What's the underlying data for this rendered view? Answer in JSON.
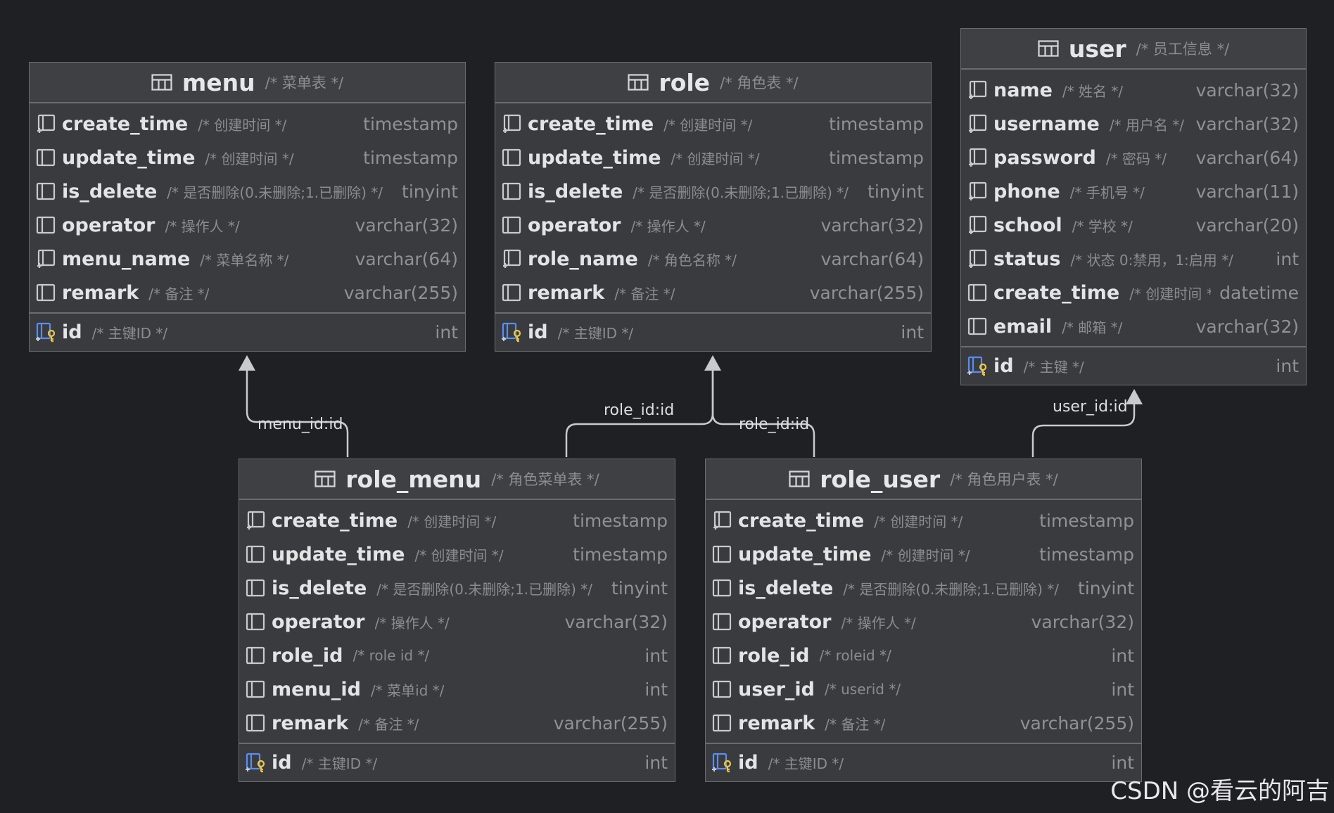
{
  "colors": {
    "background": "#1f2024",
    "entity_bg": "#393b3e",
    "border": "#6a6c70",
    "key_icon": "#f3c83a",
    "column_icon": "#c9cacd",
    "pk_icon": "#5b8def"
  },
  "entities": {
    "menu": {
      "name": "menu",
      "comment": "/* 菜单表 */",
      "columns": [
        {
          "name": "create_time",
          "comment": "/* 创建时间 */",
          "type": "timestamp",
          "icon": "column-index-icon"
        },
        {
          "name": "update_time",
          "comment": "/* 创建时间 */",
          "type": "timestamp",
          "icon": "column-icon"
        },
        {
          "name": "is_delete",
          "comment": "/* 是否删除(0.未删除;1.已删除) */",
          "type": "tinyint",
          "icon": "column-icon"
        },
        {
          "name": "operator",
          "comment": "/* 操作人 */",
          "type": "varchar(32)",
          "icon": "column-icon"
        },
        {
          "name": "menu_name",
          "comment": "/* 菜单名称 */",
          "type": "varchar(64)",
          "icon": "column-index-icon"
        },
        {
          "name": "remark",
          "comment": "/* 备注 */",
          "type": "varchar(255)",
          "icon": "column-icon"
        }
      ],
      "pk": {
        "name": "id",
        "comment": "/* 主键ID */",
        "type": "int"
      }
    },
    "role": {
      "name": "role",
      "comment": "/* 角色表 */",
      "columns": [
        {
          "name": "create_time",
          "comment": "/* 创建时间 */",
          "type": "timestamp",
          "icon": "column-index-icon"
        },
        {
          "name": "update_time",
          "comment": "/* 创建时间 */",
          "type": "timestamp",
          "icon": "column-icon"
        },
        {
          "name": "is_delete",
          "comment": "/* 是否删除(0.未删除;1.已删除) */",
          "type": "tinyint",
          "icon": "column-icon"
        },
        {
          "name": "operator",
          "comment": "/* 操作人 */",
          "type": "varchar(32)",
          "icon": "column-icon"
        },
        {
          "name": "role_name",
          "comment": "/* 角色名称 */",
          "type": "varchar(64)",
          "icon": "column-index-icon"
        },
        {
          "name": "remark",
          "comment": "/* 备注 */",
          "type": "varchar(255)",
          "icon": "column-icon"
        }
      ],
      "pk": {
        "name": "id",
        "comment": "/* 主键ID */",
        "type": "int"
      }
    },
    "user": {
      "name": "user",
      "comment": "/* 员工信息 */",
      "columns": [
        {
          "name": "name",
          "comment": "/* 姓名 */",
          "type": "varchar(32)",
          "icon": "column-index-icon"
        },
        {
          "name": "username",
          "comment": "/* 用户名 */",
          "type": "varchar(32)",
          "icon": "column-index-icon"
        },
        {
          "name": "password",
          "comment": "/* 密码 */",
          "type": "varchar(64)",
          "icon": "column-index-icon"
        },
        {
          "name": "phone",
          "comment": "/* 手机号 */",
          "type": "varchar(11)",
          "icon": "column-index-icon"
        },
        {
          "name": "school",
          "comment": "/* 学校 */",
          "type": "varchar(20)",
          "icon": "column-index-icon"
        },
        {
          "name": "status",
          "comment": "/* 状态 0:禁用，1:启用 */",
          "type": "int",
          "icon": "column-index-icon"
        },
        {
          "name": "create_time",
          "comment": "/* 创建时间 */",
          "type": "datetime",
          "icon": "column-icon"
        },
        {
          "name": "email",
          "comment": "/* 邮箱 */",
          "type": "varchar(32)",
          "icon": "column-icon"
        }
      ],
      "pk": {
        "name": "id",
        "comment": "/* 主键 */",
        "type": "int"
      }
    },
    "role_menu": {
      "name": "role_menu",
      "comment": "/* 角色菜单表 */",
      "columns": [
        {
          "name": "create_time",
          "comment": "/* 创建时间 */",
          "type": "timestamp",
          "icon": "column-index-icon"
        },
        {
          "name": "update_time",
          "comment": "/* 创建时间 */",
          "type": "timestamp",
          "icon": "column-icon"
        },
        {
          "name": "is_delete",
          "comment": "/* 是否删除(0.未删除;1.已删除) */",
          "type": "tinyint",
          "icon": "column-icon"
        },
        {
          "name": "operator",
          "comment": "/* 操作人 */",
          "type": "varchar(32)",
          "icon": "column-icon"
        },
        {
          "name": "role_id",
          "comment": "/* role id */",
          "type": "int",
          "icon": "column-icon"
        },
        {
          "name": "menu_id",
          "comment": "/* 菜单id */",
          "type": "int",
          "icon": "column-icon"
        },
        {
          "name": "remark",
          "comment": "/* 备注 */",
          "type": "varchar(255)",
          "icon": "column-icon"
        }
      ],
      "pk": {
        "name": "id",
        "comment": "/* 主键ID */",
        "type": "int"
      }
    },
    "role_user": {
      "name": "role_user",
      "comment": "/* 角色用户表 */",
      "columns": [
        {
          "name": "create_time",
          "comment": "/* 创建时间 */",
          "type": "timestamp",
          "icon": "column-index-icon"
        },
        {
          "name": "update_time",
          "comment": "/* 创建时间 */",
          "type": "timestamp",
          "icon": "column-icon"
        },
        {
          "name": "is_delete",
          "comment": "/* 是否删除(0.未删除;1.已删除) */",
          "type": "tinyint",
          "icon": "column-icon"
        },
        {
          "name": "operator",
          "comment": "/* 操作人 */",
          "type": "varchar(32)",
          "icon": "column-icon"
        },
        {
          "name": "role_id",
          "comment": "/* roleid */",
          "type": "int",
          "icon": "column-icon"
        },
        {
          "name": "user_id",
          "comment": "/* userid */",
          "type": "int",
          "icon": "column-icon"
        },
        {
          "name": "remark",
          "comment": "/* 备注 */",
          "type": "varchar(255)",
          "icon": "column-icon"
        }
      ],
      "pk": {
        "name": "id",
        "comment": "/* 主键ID */",
        "type": "int"
      }
    }
  },
  "relations": [
    {
      "label": "menu_id:id",
      "from": "role_menu",
      "to": "menu"
    },
    {
      "label": "role_id:id",
      "from": "role_menu",
      "to": "role"
    },
    {
      "label": "role_id:id",
      "from": "role_user",
      "to": "role"
    },
    {
      "label": "user_id:id",
      "from": "role_user",
      "to": "user"
    }
  ],
  "watermark": "CSDN @看云的阿吉"
}
